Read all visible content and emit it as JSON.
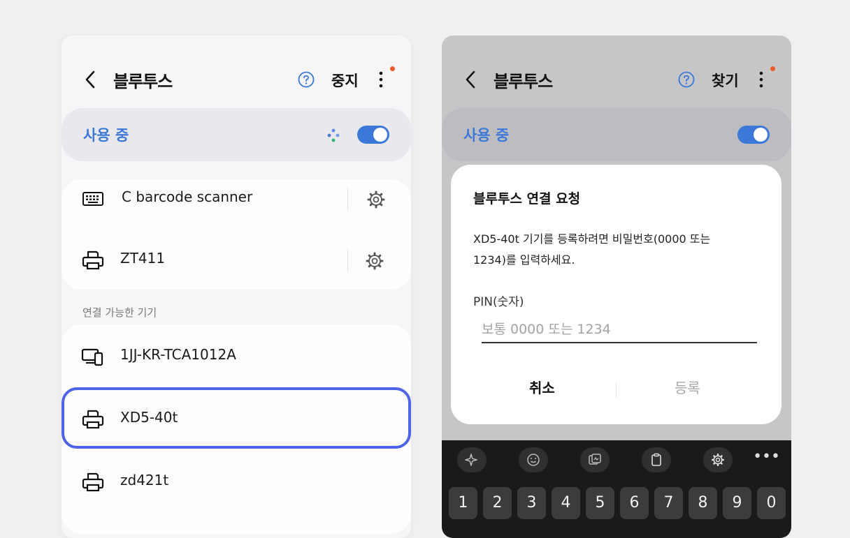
{
  "left": {
    "header": {
      "title": "블루투스",
      "action": "중지"
    },
    "toggle": {
      "label": "사용 중"
    },
    "paired": [
      {
        "name": "C barcode scanner",
        "icon": "keyboard-icon"
      },
      {
        "name": "ZT411",
        "icon": "printer-icon"
      }
    ],
    "available_label": "연결 가능한 기기",
    "available": [
      {
        "name": "1JJ-KR-TCA1012A",
        "icon": "devices-icon"
      },
      {
        "name": "XD5-40t",
        "icon": "printer-icon"
      },
      {
        "name": "zd421t",
        "icon": "printer-icon"
      }
    ],
    "colors": {
      "accent": "#3b78d8",
      "highlight": "#4f63e8",
      "notify_dot": "#ef5a2a"
    }
  },
  "right": {
    "header": {
      "title": "블루투스",
      "action": "찾기"
    },
    "toggle": {
      "label": "사용 중"
    },
    "dialog": {
      "title": "블루투스 연결 요청",
      "body_line1": "XD5-40t 기기를 등록하려면 비밀번호(0000 또는",
      "body_line2": "1234)를 입력하세요.",
      "pin_label": "PIN(숫자)",
      "pin_value": "",
      "pin_placeholder": "보통 0000 또는 1234",
      "cancel": "취소",
      "register": "등록"
    },
    "keyboard": {
      "toolbar": [
        "sparkle-icon",
        "emoji-icon",
        "sticker-icon",
        "clipboard-icon",
        "gear-icon",
        "more-icon"
      ],
      "more_label": "•••",
      "keys": [
        "1",
        "2",
        "3",
        "4",
        "5",
        "6",
        "7",
        "8",
        "9",
        "0"
      ]
    }
  }
}
